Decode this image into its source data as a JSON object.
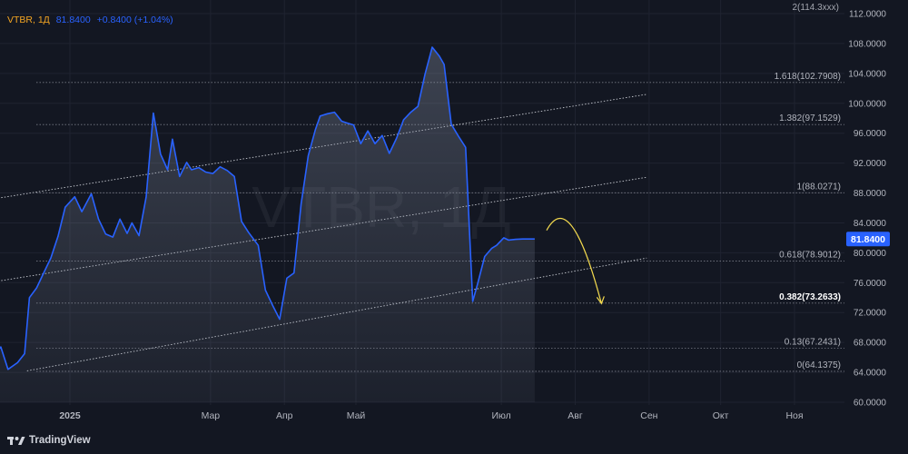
{
  "header": {
    "symbol": "VTBR, 1Д",
    "price": "81.8400",
    "change": "+0.8400 (+1.04%)"
  },
  "watermark": "VTBR, 1Д",
  "brand": "TradingView",
  "colors": {
    "background": "#131722",
    "line": "#2962ff",
    "price_tag": "#2962ff",
    "symbol_text": "#f5a623",
    "axis_text": "#b2b5be",
    "forecast_arrow": "#f2d94e",
    "fib_lines": "#787b86"
  },
  "chart_data": {
    "type": "line",
    "symbol": "VTBR",
    "timeframe": "1Д",
    "ylim": [
      60,
      112
    ],
    "y_ticks": [
      {
        "value": 60,
        "label": "60.0000"
      },
      {
        "value": 64,
        "label": "64.0000"
      },
      {
        "value": 68,
        "label": "68.0000"
      },
      {
        "value": 72,
        "label": "72.0000"
      },
      {
        "value": 76,
        "label": "76.0000"
      },
      {
        "value": 80,
        "label": "80.0000"
      },
      {
        "value": 84,
        "label": "84.0000"
      },
      {
        "value": 88,
        "label": "88.0000"
      },
      {
        "value": 92,
        "label": "92.0000"
      },
      {
        "value": 96,
        "label": "96.0000"
      },
      {
        "value": 100,
        "label": "100.0000"
      },
      {
        "value": 104,
        "label": "104.0000"
      },
      {
        "value": 108,
        "label": "108.0000"
      },
      {
        "value": 112,
        "label": "112.0000"
      }
    ],
    "x_ticks": [
      {
        "label": "2025",
        "date": "2025-01-01",
        "bold": true
      },
      {
        "label": "Мар",
        "date": "2025-03-01"
      },
      {
        "label": "Апр",
        "date": "2025-04-01"
      },
      {
        "label": "Май",
        "date": "2025-05-01"
      },
      {
        "label": "Июл",
        "date": "2025-07-01"
      },
      {
        "label": "Авг",
        "date": "2025-08-01"
      },
      {
        "label": "Сен",
        "date": "2025-09-01"
      },
      {
        "label": "Окт",
        "date": "2025-10-01"
      },
      {
        "label": "Ноя",
        "date": "2025-11-01"
      }
    ],
    "last_price": {
      "value": 81.84,
      "label": "81.8400"
    },
    "fib_levels": [
      {
        "value": 64.1375,
        "label": "0(64.1375)"
      },
      {
        "value": 67.2431,
        "label": "0.13(67.2431)"
      },
      {
        "value": 73.2633,
        "label": "0.382(73.2633)",
        "highlight": true
      },
      {
        "value": 78.9012,
        "label": "0.618(78.9012)"
      },
      {
        "value": 88.0271,
        "label": "1(88.0271)"
      },
      {
        "value": 97.1529,
        "label": "1.382(97.1529)"
      },
      {
        "value": 102.7908,
        "label": "1.618(102.7908)"
      }
    ],
    "channel_lines": [
      {
        "style": "dotted",
        "from": {
          "date": "2024-11-20",
          "value": 86.7
        },
        "to": {
          "date": "2025-08-31",
          "value": 101.2
        }
      },
      {
        "style": "dotted",
        "from": {
          "date": "2024-11-20",
          "value": 75.6
        },
        "to": {
          "date": "2025-08-31",
          "value": 90.1
        }
      },
      {
        "style": "dotted",
        "from": {
          "date": "2024-12-14",
          "value": 64.2
        },
        "to": {
          "date": "2025-08-31",
          "value": 79.3
        }
      }
    ],
    "forecast_arrow": {
      "from": {
        "date": "2025-07-20",
        "value": 83
      },
      "peak": {
        "date": "2025-07-30",
        "value": 86.2
      },
      "to": {
        "date": "2025-08-12",
        "value": 73.2
      }
    },
    "series": [
      {
        "x": [
          "2024-11-21",
          "2024-11-24",
          "2024-11-27",
          "2024-11-30",
          "2024-12-03",
          "2024-12-06",
          "2024-12-10",
          "2024-12-13",
          "2024-12-15",
          "2024-12-18",
          "2024-12-21",
          "2024-12-24",
          "2024-12-27",
          "2024-12-30",
          "2025-01-03",
          "2025-01-06",
          "2025-01-10",
          "2025-01-13",
          "2025-01-16",
          "2025-01-19",
          "2025-01-22",
          "2025-01-25",
          "2025-01-27",
          "2025-01-30",
          "2025-02-02",
          "2025-02-05",
          "2025-02-08",
          "2025-02-11",
          "2025-02-13",
          "2025-02-16",
          "2025-02-19",
          "2025-02-21",
          "2025-02-24",
          "2025-02-27",
          "2025-03-02",
          "2025-03-05",
          "2025-03-08",
          "2025-03-11",
          "2025-03-14",
          "2025-03-17",
          "2025-03-21",
          "2025-03-24",
          "2025-03-27",
          "2025-03-30",
          "2025-04-02",
          "2025-04-05",
          "2025-04-08",
          "2025-04-11",
          "2025-04-14",
          "2025-04-16",
          "2025-04-19",
          "2025-04-22",
          "2025-04-25",
          "2025-04-27",
          "2025-04-30",
          "2025-05-03",
          "2025-05-06",
          "2025-05-09",
          "2025-05-12",
          "2025-05-15",
          "2025-05-18",
          "2025-05-21",
          "2025-05-24",
          "2025-05-27",
          "2025-05-30",
          "2025-06-02",
          "2025-06-05",
          "2025-06-07",
          "2025-06-10",
          "2025-06-13",
          "2025-06-16",
          "2025-06-19",
          "2025-06-21",
          "2025-06-24",
          "2025-06-27",
          "2025-06-29",
          "2025-07-02",
          "2025-07-04",
          "2025-07-07",
          "2025-07-10",
          "2025-07-13",
          "2025-07-15"
        ],
        "values": [
          69.5,
          65.8,
          67.6,
          66.2,
          67.4,
          64.4,
          65.3,
          66.5,
          74.0,
          75.3,
          77.3,
          79.3,
          82.2,
          86.1,
          87.5,
          85.5,
          87.9,
          84.5,
          82.5,
          82.1,
          84.5,
          82.6,
          84.0,
          82.3,
          87.5,
          98.7,
          93.2,
          91.1,
          95.2,
          90.2,
          92.1,
          91.1,
          91.4,
          90.8,
          90.6,
          91.5,
          91.0,
          90.2,
          84.2,
          82.7,
          81.0,
          75.0,
          73.0,
          71.1,
          76.6,
          77.3,
          86.5,
          93.0,
          96.5,
          98.3,
          98.6,
          98.8,
          97.6,
          97.4,
          97.1,
          94.6,
          96.3,
          94.6,
          95.7,
          93.3,
          95.3,
          97.8,
          98.8,
          99.6,
          103.9,
          107.5,
          106.3,
          105.2,
          97.2,
          95.6,
          94.1,
          73.5,
          75.8,
          79.5,
          80.6,
          81.0,
          82.0,
          81.7,
          81.8,
          81.84,
          81.84,
          81.84
        ]
      }
    ]
  }
}
